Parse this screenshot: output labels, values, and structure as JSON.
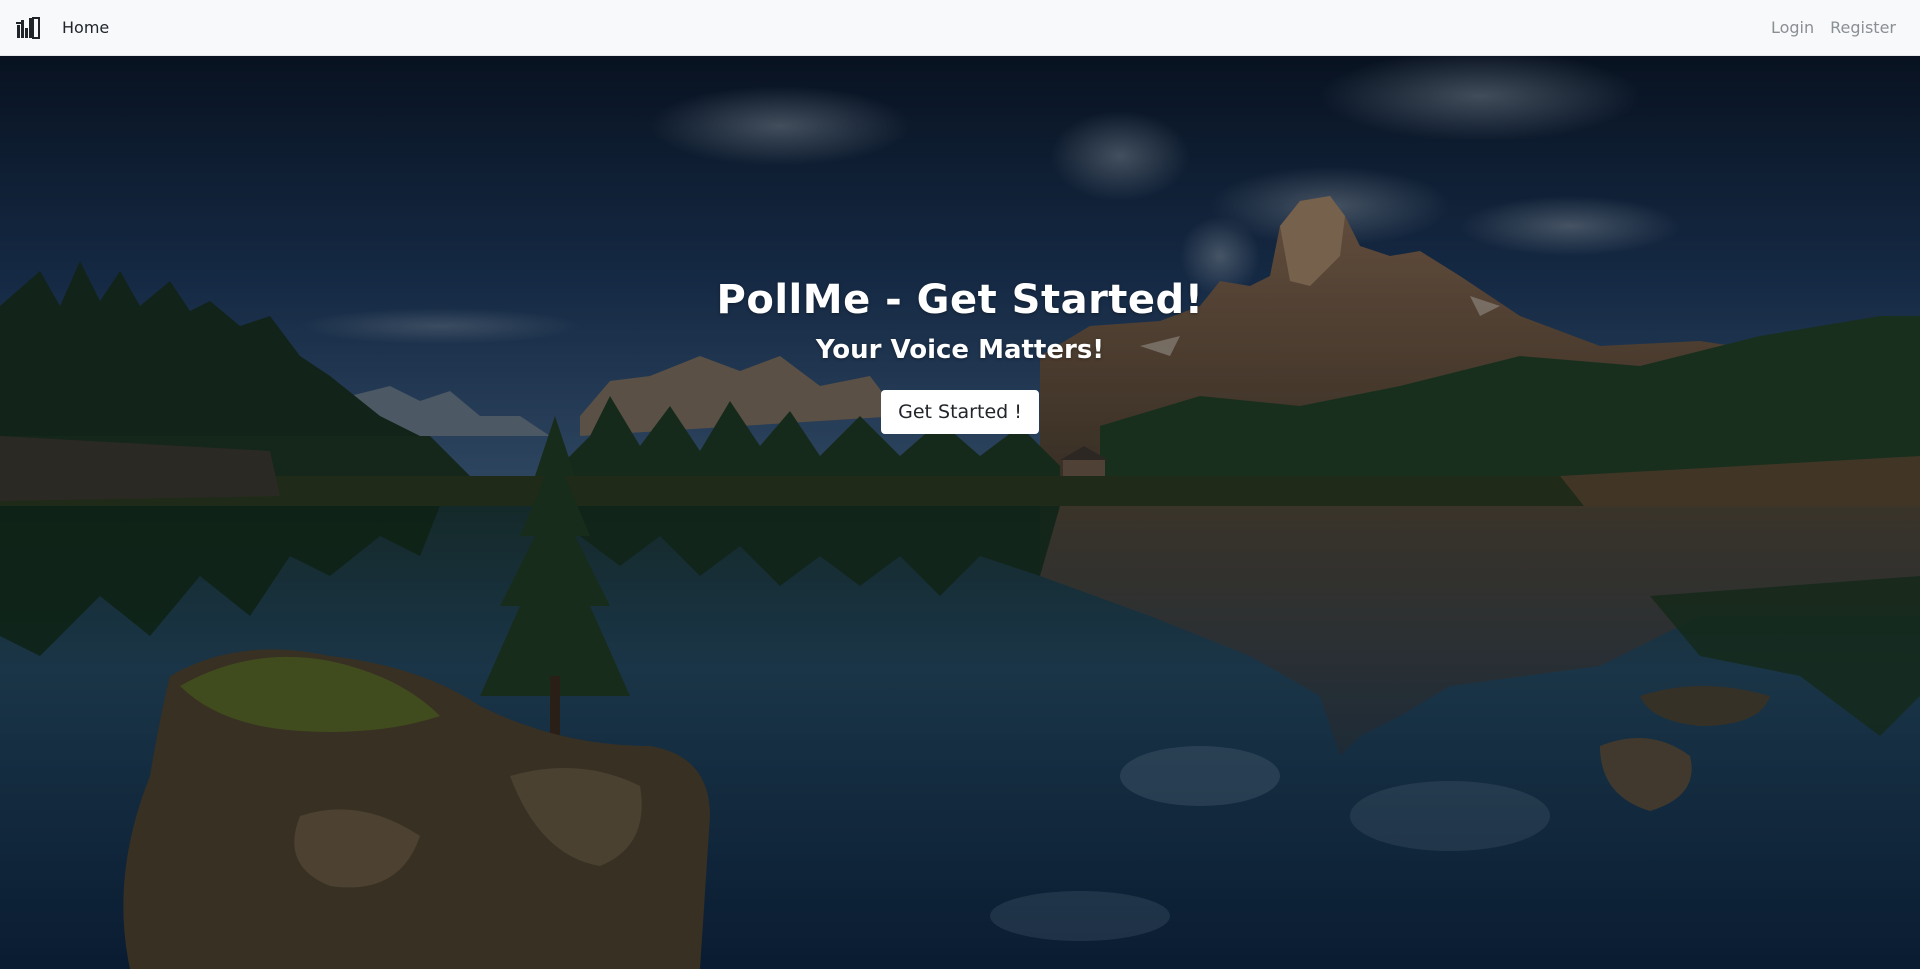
{
  "navbar": {
    "brand_icon": "poll-bars-logo-icon",
    "home_label": "Home",
    "login_label": "Login",
    "register_label": "Register"
  },
  "hero": {
    "title": "PollMe - Get Started!",
    "subtitle": "Your Voice Matters!",
    "cta_label": "Get Started !",
    "background": "mountain-lake-landscape-photo"
  },
  "colors": {
    "navbar_bg": "#f8f9fa",
    "nav_link_active": "#212529",
    "nav_link_muted": "#8a8f94",
    "hero_text": "#ffffff",
    "button_bg": "#ffffff"
  }
}
